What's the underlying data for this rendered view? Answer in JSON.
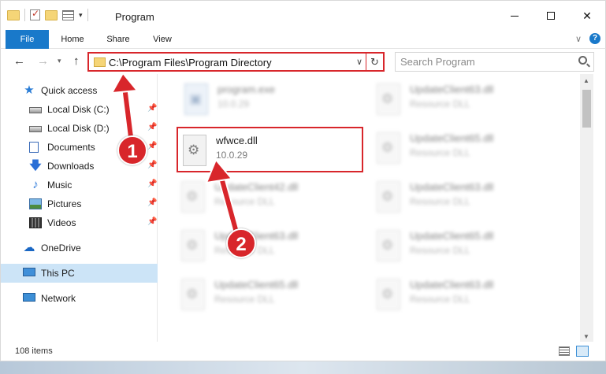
{
  "window": {
    "title": "Program",
    "controls": {
      "minimize": "–",
      "maximize": "☐",
      "close": "✕"
    }
  },
  "ribbon": {
    "tabs": [
      {
        "label": "File",
        "active": true
      },
      {
        "label": "Home"
      },
      {
        "label": "Share"
      },
      {
        "label": "View"
      }
    ],
    "help_label": "?"
  },
  "address_bar": {
    "path": "C:\\Program Files\\Program Directory",
    "refresh_glyph": "↻"
  },
  "search": {
    "placeholder": "Search Program"
  },
  "navigation": {
    "back": "←",
    "forward": "→",
    "up": "↑"
  },
  "sidebar": {
    "items": [
      {
        "label": "Quick access",
        "icon": "star-icon",
        "pinned": false
      },
      {
        "label": "Local Disk (C:)",
        "icon": "disk-icon",
        "pinned": true
      },
      {
        "label": "Local Disk (D:)",
        "icon": "disk-icon",
        "pinned": true
      },
      {
        "label": "Documents",
        "icon": "documents-icon",
        "pinned": true
      },
      {
        "label": "Downloads",
        "icon": "downloads-icon",
        "pinned": true
      },
      {
        "label": "Music",
        "icon": "music-icon",
        "pinned": true
      },
      {
        "label": "Pictures",
        "icon": "pictures-icon",
        "pinned": true
      },
      {
        "label": "Videos",
        "icon": "videos-icon",
        "pinned": true
      },
      {
        "label": "OneDrive",
        "icon": "cloud-icon"
      },
      {
        "label": "This PC",
        "icon": "computer-icon",
        "selected": true
      },
      {
        "label": "Network",
        "icon": "network-icon"
      }
    ]
  },
  "files": [
    {
      "name": "program.exe",
      "detail": "10.0.29",
      "icon": "exe-icon",
      "blurred": true
    },
    {
      "name": "UpdateClient63.dll",
      "detail": "Resource DLL",
      "icon": "dll-icon",
      "blurred": true
    },
    {
      "name": "wfwce.dll",
      "detail": "10.0.29",
      "icon": "dll-icon",
      "highlighted": true
    },
    {
      "name": "UpdateClient65.dll",
      "detail": "Resource DLL",
      "icon": "dll-icon",
      "blurred": true
    },
    {
      "name": "UpdateClient42.dll",
      "detail": "Resource DLL",
      "icon": "dll-icon",
      "blurred": true
    },
    {
      "name": "UpdateClient63.dll",
      "detail": "Resource DLL",
      "icon": "dll-icon",
      "blurred": true
    },
    {
      "name": "UpdateClient63.dll",
      "detail": "Resource DLL",
      "icon": "dll-icon",
      "blurred": true
    },
    {
      "name": "UpdateClient65.dll",
      "detail": "Resource DLL",
      "icon": "dll-icon",
      "blurred": true
    },
    {
      "name": "UpdateClient65.dll",
      "detail": "Resource DLL",
      "icon": "dll-icon",
      "blurred": true
    },
    {
      "name": "UpdateClient63.dll",
      "detail": "Resource DLL",
      "icon": "dll-icon",
      "blurred": true
    }
  ],
  "status": {
    "item_count": "108 items"
  },
  "annotations": {
    "step1": "1",
    "step2": "2"
  },
  "colors": {
    "accent": "#1979ca",
    "highlight": "#d8262b",
    "selection": "#cce4f7"
  }
}
